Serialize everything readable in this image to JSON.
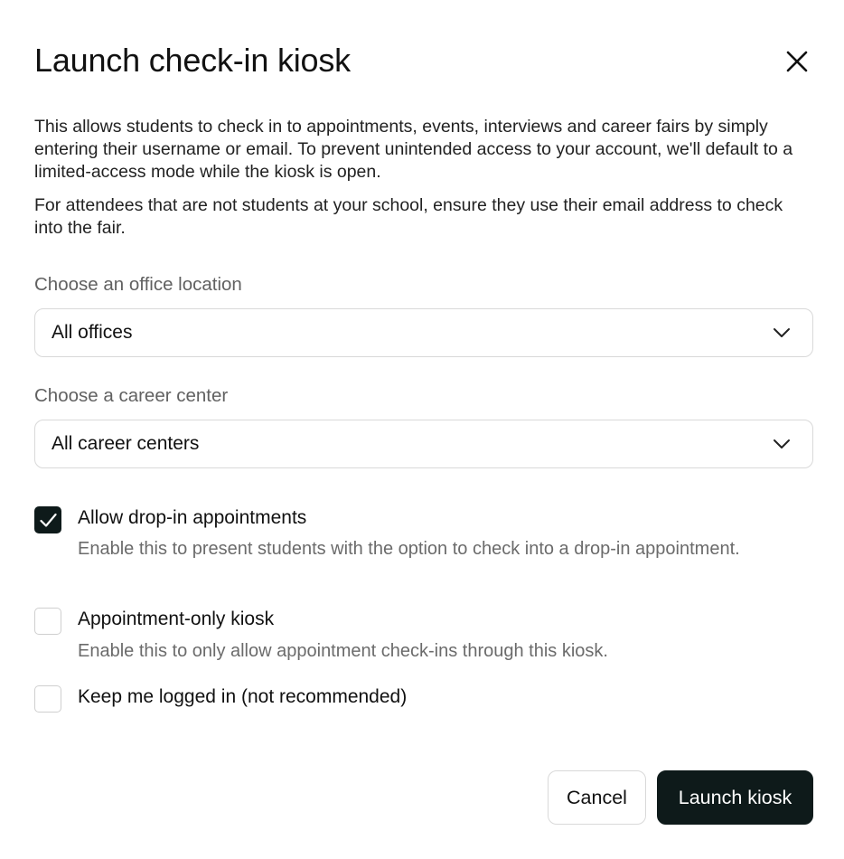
{
  "dialog": {
    "title": "Launch check-in kiosk",
    "close_icon": "close-icon",
    "description": [
      "This allows students to check in to appointments, events, interviews and career fairs by simply entering their username or email. To prevent unintended access to your account, we'll default to a limited-access mode while the kiosk is open.",
      "For attendees that are not students at your school, ensure they use their email address to check into the fair."
    ]
  },
  "office_location": {
    "label": "Choose an office location",
    "selected": "All offices",
    "icon": "chevron-down-icon"
  },
  "career_center": {
    "label": "Choose a career center",
    "selected": "All career centers",
    "icon": "chevron-down-icon"
  },
  "options": [
    {
      "label": "Allow drop-in appointments",
      "help": "Enable this to present students with the option to check into a drop-in appointment.",
      "checked": true
    },
    {
      "label": "Appointment-only kiosk",
      "help": "Enable this to only allow appointment check-ins through this kiosk.",
      "checked": false
    },
    {
      "label": "Keep me logged in (not recommended)",
      "help": "",
      "checked": false
    }
  ],
  "actions": {
    "cancel_label": "Cancel",
    "launch_label": "Launch kiosk"
  },
  "colors": {
    "primary": "#0e1a1a",
    "label_gray": "#616161",
    "help_gray": "#6b6b6b",
    "border": "#d9d9d9"
  }
}
